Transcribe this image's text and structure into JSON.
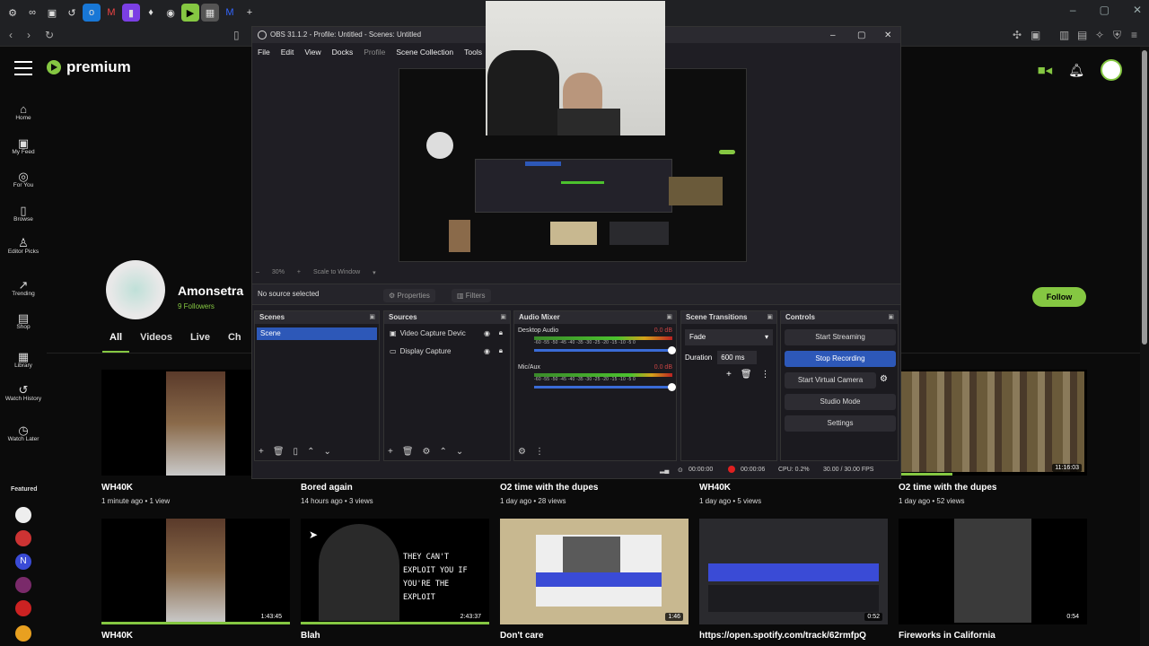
{
  "site": {
    "logo_text": "premium",
    "sidebar": [
      {
        "icon": "home-icon",
        "label": "Home",
        "glyph": "⌂"
      },
      {
        "icon": "my-feed-icon",
        "label": "My Feed",
        "glyph": "▣"
      },
      {
        "icon": "for-you-icon",
        "label": "For You",
        "glyph": "◎"
      },
      {
        "icon": "browse-icon",
        "label": "Browse",
        "glyph": "▯"
      },
      {
        "icon": "editor-picks-icon",
        "label": "Editor Picks",
        "glyph": "♙"
      },
      {
        "icon": "trending-icon",
        "label": "Trending",
        "glyph": "↗"
      },
      {
        "icon": "shop-icon",
        "label": "Shop",
        "glyph": "▤"
      },
      {
        "icon": "library-icon",
        "label": "Library",
        "glyph": "▦"
      },
      {
        "icon": "watch-history-icon",
        "label": "Watch History",
        "glyph": "↺"
      },
      {
        "icon": "watch-later-icon",
        "label": "Watch Later",
        "glyph": "◷"
      }
    ],
    "featured_label": "Featured",
    "channel": {
      "name": "Amonsetra",
      "followers": "9 Followers",
      "follow_label": "Follow"
    },
    "tabs": [
      "All",
      "Videos",
      "Live",
      "Ch"
    ],
    "videos_row1": [
      {
        "title": "WH40K",
        "meta": "1 minute ago • 1 view"
      },
      {
        "title": "Bored again",
        "meta": "14 hours ago • 3 views"
      },
      {
        "title": "O2 time with the dupes",
        "meta": "1 day ago • 28 views"
      },
      {
        "title": "WH40K",
        "meta": "1 day ago • 5 views"
      },
      {
        "title": "O2 time with the dupes",
        "meta": "1 day ago • 52 views",
        "duration": "11:16:03"
      }
    ],
    "videos_row2": [
      {
        "title": "WH40K",
        "duration": "1:43:45"
      },
      {
        "title": "Blah",
        "duration": "2:43:37",
        "thumb_text": "THEY CAN'T EXPLOIT YOU IF YOU'RE THE EXPLOIT"
      },
      {
        "title": "Don't care",
        "duration": "1:46"
      },
      {
        "title": "https://open.spotify.com/track/62rmfpQ",
        "duration": "0:52"
      },
      {
        "title": "Fireworks in California",
        "duration": "0:54"
      }
    ]
  },
  "obs": {
    "title": "OBS 31.1.2 - Profile: Untitled - Scenes: Untitled",
    "menu": [
      "File",
      "Edit",
      "View",
      "Docks",
      "Profile",
      "Scene Collection",
      "Tools"
    ],
    "zoom": "30%",
    "scale_label": "Scale to Window",
    "no_source": "No source selected",
    "properties_label": "Properties",
    "filters_label": "Filters",
    "docks": {
      "scenes": {
        "title": "Scenes",
        "items": [
          "Scene"
        ]
      },
      "sources": {
        "title": "Sources",
        "items": [
          "Video Capture Devic",
          "Display Capture"
        ]
      },
      "mixer": {
        "title": "Audio Mixer",
        "channels": [
          {
            "name": "Desktop Audio",
            "db": "0.0 dB"
          },
          {
            "name": "Mic/Aux",
            "db": "0.0 dB"
          }
        ],
        "ticks": "-60 -55 -50 -45 -40 -35 -30 -25 -20 -15 -10 -5 0"
      },
      "transitions": {
        "title": "Scene Transitions",
        "value": "Fade",
        "duration_label": "Duration",
        "duration_value": "600 ms"
      },
      "controls": {
        "title": "Controls",
        "buttons": [
          "Start Streaming",
          "Stop Recording",
          "Start Virtual Camera",
          "Studio Mode",
          "Settings"
        ]
      }
    },
    "status": {
      "stream_time": "00:00:00",
      "rec_time": "00:00:06",
      "cpu": "CPU: 0.2%",
      "fps": "30.00 / 30.00 FPS"
    }
  },
  "colors": {
    "accent": "#85c742",
    "obs_blue": "#2d58b8",
    "record": "#e02020"
  }
}
